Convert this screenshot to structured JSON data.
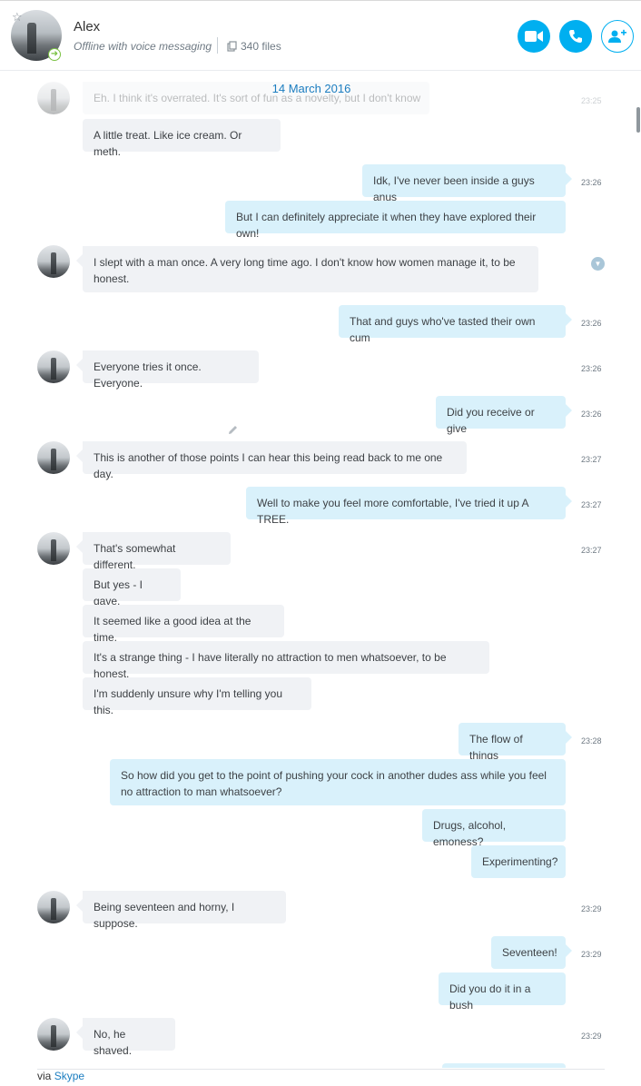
{
  "contact": {
    "name": "Alex",
    "status": "Offline with voice messaging",
    "files": "340 files"
  },
  "header_actions": [
    {
      "name": "video-call-button",
      "icon": "video-camera-icon"
    },
    {
      "name": "audio-call-button",
      "icon": "phone-icon"
    },
    {
      "name": "add-people-button",
      "icon": "add-person-icon"
    }
  ],
  "date_divider": "14 March 2016",
  "messages": {
    "m0": {
      "text": "Eh. I think it's overrated. It's sort of fun as a novelty, but I don't know",
      "time": "23:25"
    },
    "m1": {
      "text": "A little treat. Like ice cream. Or meth."
    },
    "m2": {
      "text": "Idk, I've never been inside a guys anus",
      "time": "23:26"
    },
    "m3": {
      "text": "But I can definitely appreciate it when they have explored their own!"
    },
    "m4": {
      "text": "I slept with a man once. A very long time ago. I don't know how women manage it, to be honest."
    },
    "m5": {
      "text": "That and guys who've tasted their own cum",
      "time": "23:26"
    },
    "m6": {
      "text": "Everyone tries it once. Everyone.",
      "time": "23:26"
    },
    "m7": {
      "text": "Did you receive or give",
      "time": "23:26"
    },
    "m8": {
      "text": "This is another of those points I can hear this being read back to me one day.",
      "time": "23:27"
    },
    "m9": {
      "text": "Well to make you feel more comfortable, I've tried it up A TREE.",
      "time": "23:27"
    },
    "m10": {
      "text": "That's somewhat different,",
      "time": "23:27"
    },
    "m11": {
      "text": "But yes - I gave."
    },
    "m12": {
      "text": "It seemed like a good idea at the time."
    },
    "m13": {
      "text": "It's a strange thing - I have literally no attraction to men whatsoever, to be honest."
    },
    "m14": {
      "text": "I'm suddenly unsure why I'm telling you this."
    },
    "m15": {
      "text": "The flow of things",
      "time": "23:28"
    },
    "m16": {
      "text": "So how did you get to the point of pushing your cock in another dudes ass while you feel no attraction to man whatsoever?"
    },
    "m17": {
      "text": "Drugs, alcohol, emoness?"
    },
    "m18": {
      "text": "Experimenting?"
    },
    "m19": {
      "text": "Being seventeen and horny, I suppose.",
      "time": "23:29"
    },
    "m20": {
      "text": "Seventeen!",
      "time": "23:29"
    },
    "m21": {
      "text": "Did you do it in a bush"
    },
    "m22": {
      "text": "No, he shaved.",
      "time": "23:29"
    }
  },
  "footer": {
    "prefix": "via ",
    "link": "Skype"
  },
  "colors": {
    "accent": "#00aff0",
    "incoming_bubble": "#f0f2f5",
    "outgoing_bubble": "#d9f1fb",
    "link": "#1b7dc0"
  }
}
